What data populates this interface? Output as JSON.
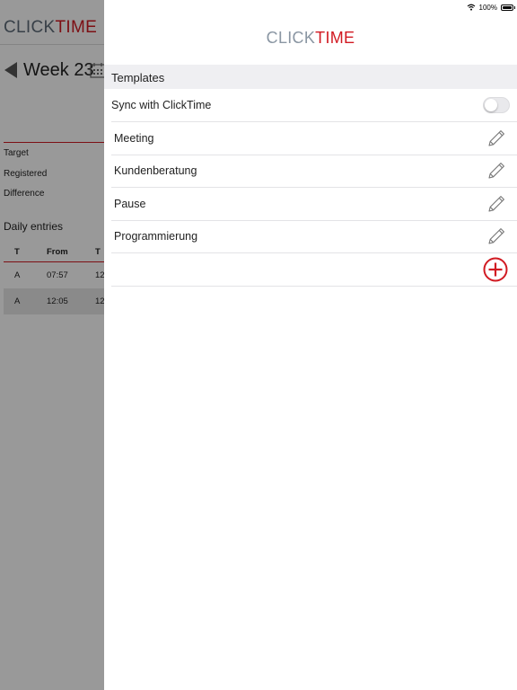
{
  "background": {
    "logo_click": "CLICK",
    "logo_time": "TIME",
    "week_label": "Week 23",
    "labels": {
      "target": "Target",
      "registered": "Registered",
      "difference": "Difference"
    },
    "daily_entries_title": "Daily entries",
    "table": {
      "headers": [
        "T",
        "From",
        "T"
      ],
      "rows": [
        [
          "A",
          "07:57",
          "12"
        ],
        [
          "A",
          "12:05",
          "12"
        ]
      ]
    }
  },
  "status_bar": {
    "battery_text": "100%"
  },
  "panel": {
    "logo_click": "CLICK",
    "logo_time": "TIME",
    "section_title": "Templates",
    "sync_label": "Sync with ClickTime",
    "sync_enabled": false,
    "templates": [
      {
        "label": "Meeting"
      },
      {
        "label": "Kundenberatung"
      },
      {
        "label": "Pause"
      },
      {
        "label": "Programmierung"
      }
    ]
  },
  "colors": {
    "brand_red": "#d11a22",
    "brand_gray": "#8a96a3",
    "section_bg": "#efeff2",
    "overlay": "rgba(0,0,0,0.4)"
  },
  "icons": {
    "back": "back-arrow-icon",
    "calendar": "calendar-icon",
    "wifi": "wifi-icon",
    "battery": "battery-icon",
    "edit": "pencil-icon",
    "add": "add-circle-icon"
  }
}
